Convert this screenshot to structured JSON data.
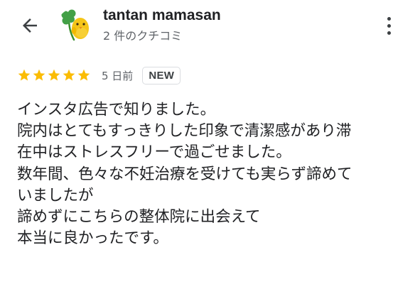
{
  "header": {
    "back_icon": "arrow-back-icon",
    "avatar_icon": "chick-with-clover-avatar",
    "user_name": "tantan mamasan",
    "review_count": "2 件のクチコミ",
    "more_icon": "more-vertical-icon"
  },
  "review": {
    "rating": 5,
    "rating_max": 5,
    "star_color": "#fbbc04",
    "date": "5 日前",
    "badge": "NEW",
    "lines": [
      "インスタ広告で知りました。",
      "院内はとてもすっきりした印象で清潔感があり滞",
      "在中はストレスフリーで過ごせました。",
      "数年間、色々な不妊治療を受けても実らず諦めて",
      "いましたが",
      "諦めずにこちらの整体院に出会えて",
      "本当に良かったです。"
    ]
  }
}
